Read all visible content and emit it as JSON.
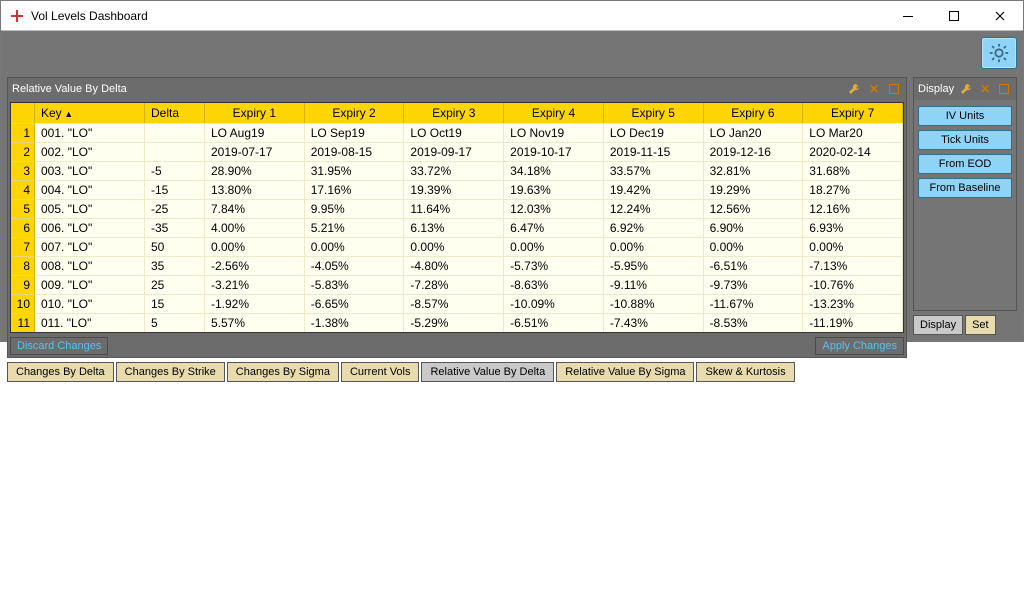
{
  "window": {
    "title": "Vol Levels Dashboard"
  },
  "main_panel": {
    "title": "Relative Value By Delta",
    "discard_label": "Discard Changes",
    "apply_label": "Apply Changes",
    "columns": [
      "",
      "Key",
      "Delta",
      "Expiry 1",
      "Expiry 2",
      "Expiry 3",
      "Expiry 4",
      "Expiry 5",
      "Expiry 6",
      "Expiry 7"
    ],
    "sort_column": "Key",
    "rows": [
      {
        "n": "1",
        "key": "001. \"LO\"",
        "delta": "",
        "c": [
          "LO Aug19",
          "LO Sep19",
          "LO Oct19",
          "LO Nov19",
          "LO Dec19",
          "LO Jan20",
          "LO Mar20"
        ]
      },
      {
        "n": "2",
        "key": "002. \"LO\"",
        "delta": "",
        "c": [
          "2019-07-17",
          "2019-08-15",
          "2019-09-17",
          "2019-10-17",
          "2019-11-15",
          "2019-12-16",
          "2020-02-14"
        ]
      },
      {
        "n": "3",
        "key": "003. \"LO\"",
        "delta": "-5",
        "c": [
          "28.90%",
          "31.95%",
          "33.72%",
          "34.18%",
          "33.57%",
          "32.81%",
          "31.68%"
        ]
      },
      {
        "n": "4",
        "key": "004. \"LO\"",
        "delta": "-15",
        "c": [
          "13.80%",
          "17.16%",
          "19.39%",
          "19.63%",
          "19.42%",
          "19.29%",
          "18.27%"
        ]
      },
      {
        "n": "5",
        "key": "005. \"LO\"",
        "delta": "-25",
        "c": [
          "7.84%",
          "9.95%",
          "11.64%",
          "12.03%",
          "12.24%",
          "12.56%",
          "12.16%"
        ]
      },
      {
        "n": "6",
        "key": "006. \"LO\"",
        "delta": "-35",
        "c": [
          "4.00%",
          "5.21%",
          "6.13%",
          "6.47%",
          "6.92%",
          "6.90%",
          "6.93%"
        ]
      },
      {
        "n": "7",
        "key": "007. \"LO\"",
        "delta": "50",
        "c": [
          "0.00%",
          "0.00%",
          "0.00%",
          "0.00%",
          "0.00%",
          "0.00%",
          "0.00%"
        ]
      },
      {
        "n": "8",
        "key": "008. \"LO\"",
        "delta": "35",
        "c": [
          "-2.56%",
          "-4.05%",
          "-4.80%",
          "-5.73%",
          "-5.95%",
          "-6.51%",
          "-7.13%"
        ]
      },
      {
        "n": "9",
        "key": "009. \"LO\"",
        "delta": "25",
        "c": [
          "-3.21%",
          "-5.83%",
          "-7.28%",
          "-8.63%",
          "-9.11%",
          "-9.73%",
          "-10.76%"
        ]
      },
      {
        "n": "10",
        "key": "010. \"LO\"",
        "delta": "15",
        "c": [
          "-1.92%",
          "-6.65%",
          "-8.57%",
          "-10.09%",
          "-10.88%",
          "-11.67%",
          "-13.23%"
        ]
      },
      {
        "n": "11",
        "key": "011. \"LO\"",
        "delta": "5",
        "c": [
          "5.57%",
          "-1.38%",
          "-5.29%",
          "-6.51%",
          "-7.43%",
          "-8.53%",
          "-11.19%"
        ]
      }
    ]
  },
  "tabs": {
    "items": [
      "Changes By Delta",
      "Changes By Strike",
      "Changes By Sigma",
      "Current Vols",
      "Relative Value By Delta",
      "Relative Value By Sigma",
      "Skew & Kurtosis"
    ],
    "active_index": 4
  },
  "side_panel": {
    "title": "Display",
    "buttons": [
      "IV Units",
      "Tick Units",
      "From EOD",
      "From Baseline"
    ]
  },
  "side_tabs": {
    "items": [
      "Display",
      "Set"
    ],
    "active_index": 0
  },
  "icons": {
    "wrench": "wrench-icon",
    "x": "close-panel-icon",
    "sq": "restore-panel-icon",
    "gear": "gear-icon"
  }
}
